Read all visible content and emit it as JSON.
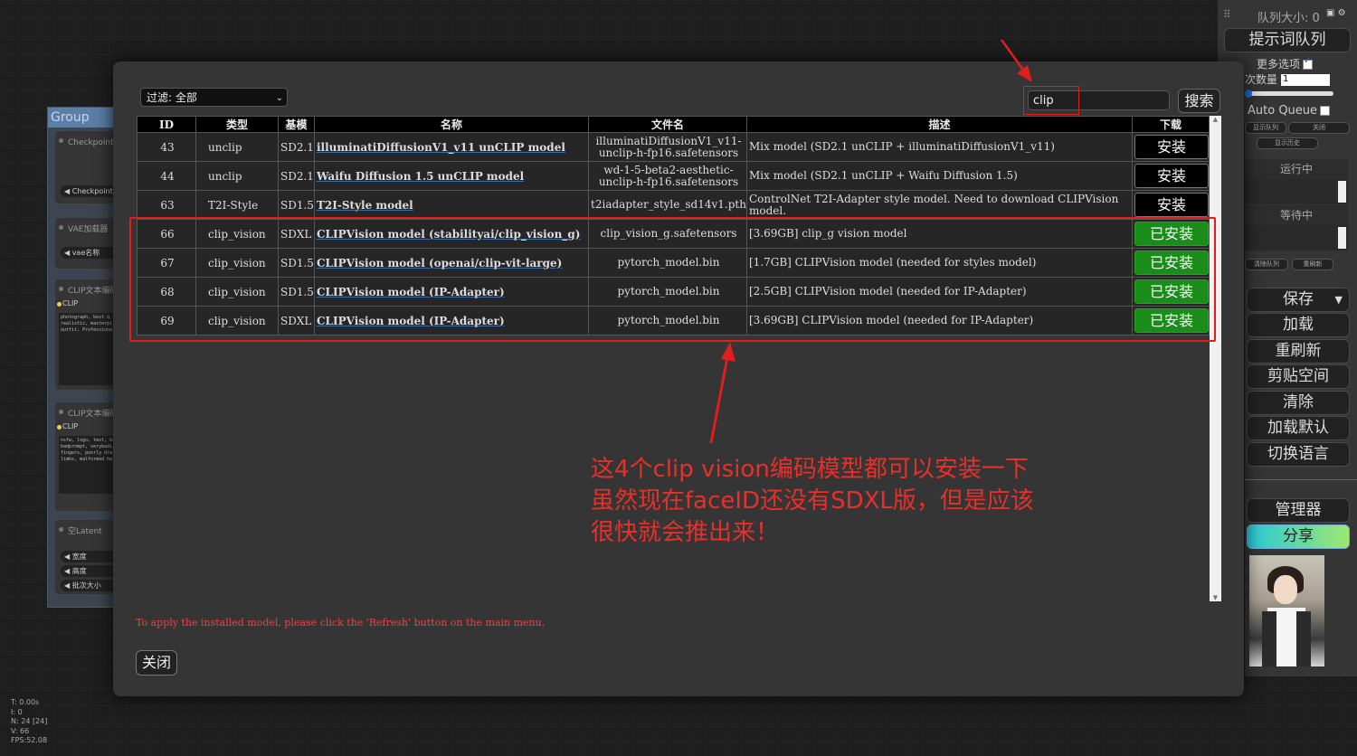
{
  "background": {
    "group_title": "Group",
    "nodes": [
      {
        "title": "Checkpoint加",
        "slot": "◀ Checkpoint名"
      },
      {
        "title": "VAE加载器",
        "slot": "◀ vae名称"
      },
      {
        "title": "CLIP文本编码",
        "out": "CLIP",
        "text": "photograph, best q\nrealistic, masterpi\noutfit, Professiona"
      },
      {
        "title": "CLIP文本编码",
        "out": "CLIP",
        "text": "nsfw, logo, text, bad\nbadprompt, verybadi\nfingers, poorly dra\nlimbs, malformed ha"
      },
      {
        "title": "空Latent",
        "slots": [
          "◀ 宽度",
          "◀ 高度",
          "◀ 批次大小"
        ]
      }
    ],
    "stats": [
      "T: 0.00s",
      "I: 0",
      "N: 24 [24]",
      "V: 66",
      "FPS:52.08"
    ]
  },
  "side_menu": {
    "queue_size": "队列大小: 0",
    "queue_prompt": "提示词队列",
    "more_options": "更多选项",
    "batch_count_label": "次数量",
    "batch_count_value": "1",
    "auto_queue": "Auto Queue",
    "mini_buttons": [
      "显示队列",
      "关闭",
      "显示历史"
    ],
    "running": "运行中",
    "pending": "等待中",
    "clear_queue": "清除队列",
    "refresh_small": "重刷新",
    "buttons": [
      "保存",
      "加载",
      "重刷新",
      "剪贴空间",
      "清除",
      "加载默认",
      "切换语言"
    ],
    "manager": "管理器",
    "share": "分享"
  },
  "dialog": {
    "filter": "过滤: 全部",
    "search_value": "clip",
    "search_button": "搜索",
    "columns": [
      "ID",
      "类型",
      "基模",
      "名称",
      "文件名",
      "描述",
      "下载"
    ],
    "rows": [
      {
        "id": "43",
        "type": "unclip",
        "base": "SD2.1",
        "name": "illuminatiDiffusionV1_v11 unCLIP model",
        "file": "illuminatiDiffusionV1_v11-unclip-h-fp16.safetensors",
        "desc": "Mix model (SD2.1 unCLIP + illuminatiDiffusionV1_v11)",
        "action": "安装",
        "installed": false
      },
      {
        "id": "44",
        "type": "unclip",
        "base": "SD2.1",
        "name": "Waifu Diffusion 1.5 unCLIP model",
        "file": "wd-1-5-beta2-aesthetic-unclip-h-fp16.safetensors",
        "desc": "Mix model (SD2.1 unCLIP + Waifu Diffusion 1.5)",
        "action": "安装",
        "installed": false
      },
      {
        "id": "63",
        "type": "T2I-Style",
        "base": "SD1.5",
        "name": "T2I-Style model",
        "file": "t2iadapter_style_sd14v1.pth",
        "desc": "ControlNet T2I-Adapter style model. Need to download CLIPVision model.",
        "action": "安装",
        "installed": false
      },
      {
        "id": "66",
        "type": "clip_vision",
        "base": "SDXL",
        "name": "CLIPVision model (stabilityai/clip_vision_g)",
        "file": "clip_vision_g.safetensors",
        "desc": "[3.69GB] clip_g vision model",
        "action": "已安装",
        "installed": true
      },
      {
        "id": "67",
        "type": "clip_vision",
        "base": "SD1.5",
        "name": "CLIPVision model (openai/clip-vit-large)",
        "file": "pytorch_model.bin",
        "desc": "[1.7GB] CLIPVision model (needed for styles model)",
        "action": "已安装",
        "installed": true
      },
      {
        "id": "68",
        "type": "clip_vision",
        "base": "SD1.5",
        "name": "CLIPVision model (IP-Adapter)",
        "file": "pytorch_model.bin",
        "desc": "[2.5GB] CLIPVision model (needed for IP-Adapter)",
        "action": "已安装",
        "installed": true
      },
      {
        "id": "69",
        "type": "clip_vision",
        "base": "SDXL",
        "name": "CLIPVision model (IP-Adapter)",
        "file": "pytorch_model.bin",
        "desc": "[3.69GB] CLIPVision model (needed for IP-Adapter)",
        "action": "已安装",
        "installed": true
      }
    ],
    "hint": "To apply the installed model, please click the 'Refresh' button on the main menu.",
    "close_button": "关闭"
  },
  "annotation": {
    "lines": [
      "这4个clip vision编码模型都可以安装一下",
      "虽然现在faceID还没有SDXL版，但是应该",
      "很快就会推出来！"
    ],
    "color": "#e8302a"
  }
}
